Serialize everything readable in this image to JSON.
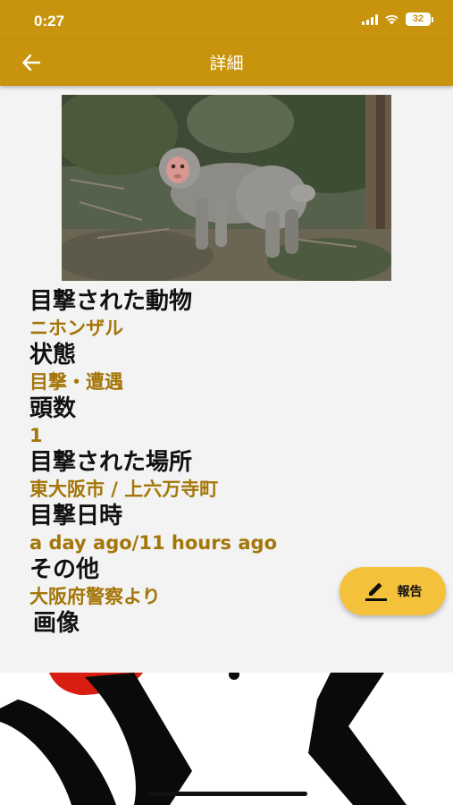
{
  "status_bar": {
    "time": "0:27",
    "battery": "32"
  },
  "app_bar": {
    "title": "詳細",
    "back_icon": "arrow-left-icon"
  },
  "photo": {
    "description_icon": "monkey-photo"
  },
  "details": [
    {
      "label": "目撃された動物",
      "value": "ニホンザル"
    },
    {
      "label": "状態",
      "value": "目撃・遭遇"
    },
    {
      "label": "頭数",
      "value": "1"
    },
    {
      "label": "目撃された場所",
      "value": "東大阪市 / 上六万寺町"
    },
    {
      "label": "目撃日時",
      "value": "a day ago/11 hours ago"
    },
    {
      "label": "その他",
      "value": "大阪府警察より"
    }
  ],
  "image_section": {
    "label": "画像"
  },
  "report_button": {
    "label": "報告",
    "icon": "edit-icon"
  },
  "colors": {
    "accent": "#c8940e",
    "value_text": "#a4760a",
    "fab": "#f4c13a"
  }
}
